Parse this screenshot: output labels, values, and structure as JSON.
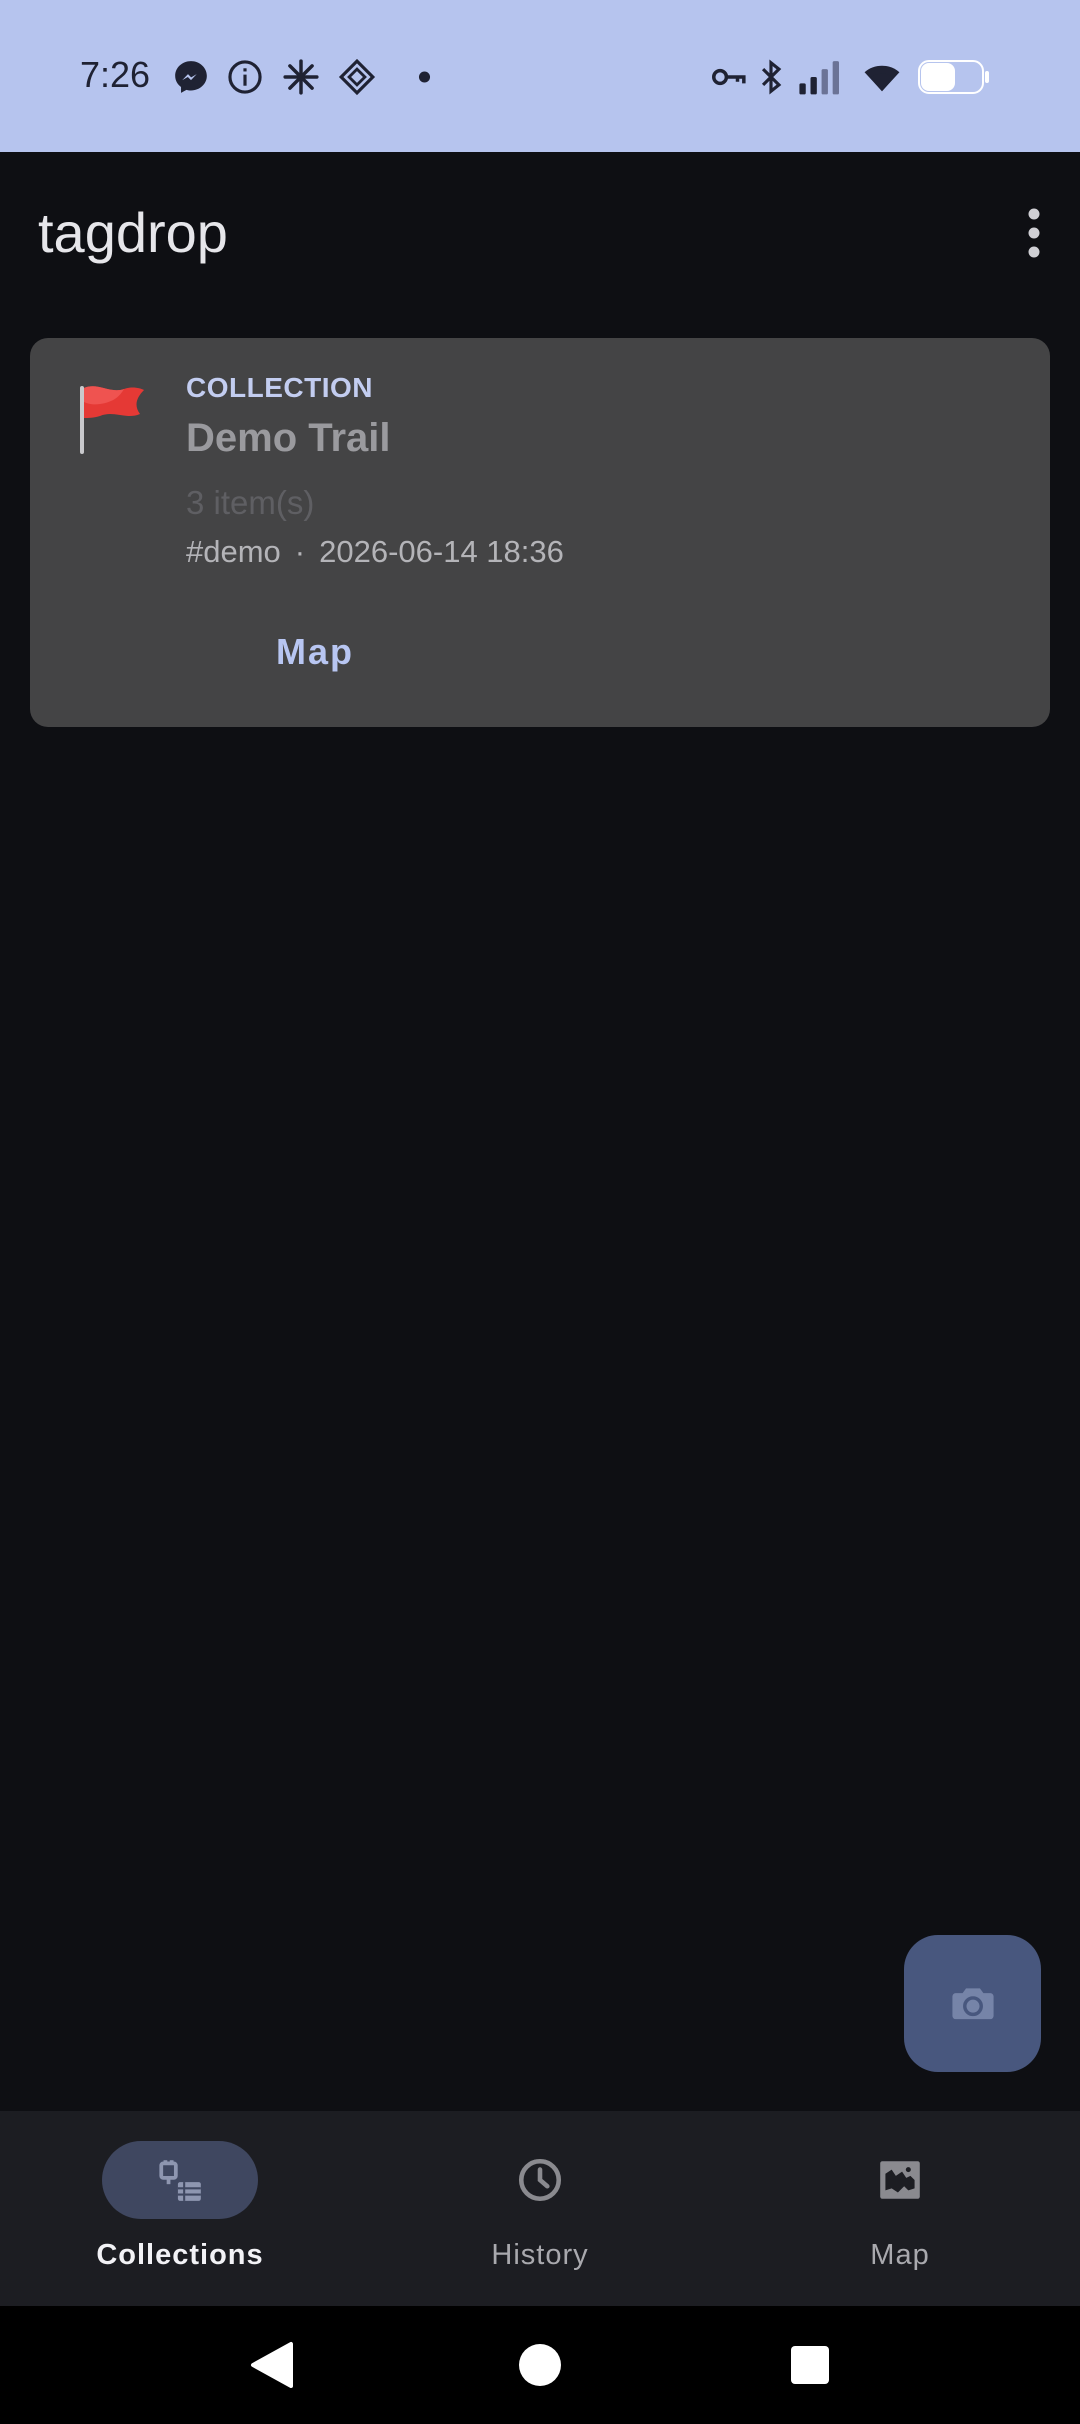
{
  "status_bar": {
    "time": "7:26",
    "left_icons": [
      "messenger-icon",
      "info-icon",
      "sparkle-icon",
      "diamond-app-icon",
      "dot-icon"
    ],
    "right_icons": [
      "vpn-key-icon",
      "bluetooth-icon",
      "signal-icon",
      "wifi-icon",
      "battery-icon"
    ]
  },
  "app_bar": {
    "title": "tagdrop",
    "menu_icon": "more-vert-icon"
  },
  "collections": [
    {
      "kind": "COLLECTION",
      "icon": "red-flag-icon",
      "title": "Demo Trail",
      "count": "3 item(s)",
      "tag": "#demo",
      "separator": "·",
      "date": "2026-06-14 18:36",
      "action_label": "Map"
    }
  ],
  "fab": {
    "icon": "camera-icon"
  },
  "bottom_nav": {
    "items": [
      {
        "label": "Collections",
        "icon": "collections-icon",
        "active": true
      },
      {
        "label": "History",
        "icon": "history-clock-icon",
        "active": false
      },
      {
        "label": "Map",
        "icon": "map-icon",
        "active": false
      }
    ]
  },
  "system_nav": {
    "icons": [
      "back-icon",
      "home-icon",
      "recents-icon"
    ]
  },
  "colors": {
    "status_bar": "#b6c4ee",
    "background": "#0e0f13",
    "card": "#444445",
    "accent": "#b8c6f2",
    "fab": "#48577e",
    "nav_bar": "#1c1d22",
    "nav_indicator": "#3f4760"
  }
}
